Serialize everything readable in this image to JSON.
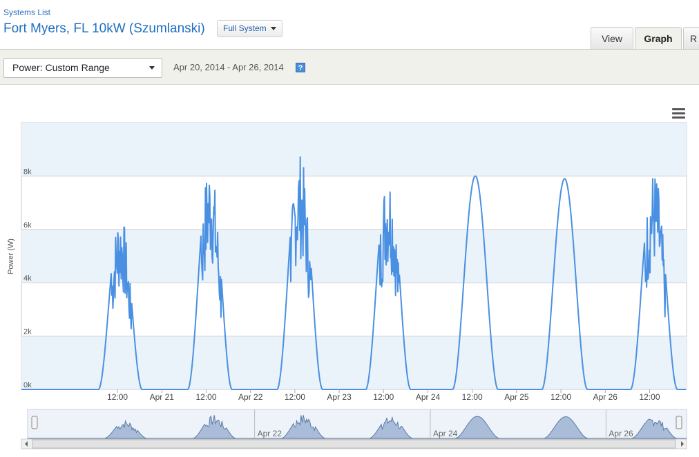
{
  "header": {
    "breadcrumb": "Systems List",
    "title": "Fort Myers, FL 10kW (Szumlanski)",
    "system_select": "Full System"
  },
  "tabs": [
    {
      "label": "View",
      "active": false
    },
    {
      "label": "Graph",
      "active": true
    },
    {
      "label": "R",
      "active": false
    }
  ],
  "toolbar": {
    "range_select": "Power: Custom Range",
    "date_range": "Apr 20, 2014 - Apr 26, 2014",
    "help": "?"
  },
  "colors": {
    "line": "#4a90e2",
    "band": "#eaf2fa",
    "navigator_fill": "#a9bdd9",
    "navigator_line": "#5a79a6"
  },
  "chart_data": {
    "type": "line",
    "title": "",
    "xlabel": "",
    "ylabel": "Power (W)",
    "ylim": [
      0,
      10000
    ],
    "yticks": [
      0,
      2000,
      4000,
      6000,
      8000
    ],
    "ytick_labels": [
      "0k",
      "2k",
      "4k",
      "6k",
      "8k"
    ],
    "xlim_hours": [
      -14,
      166
    ],
    "x_tick_labels": [
      "12:00",
      "Apr 21",
      "12:00",
      "Apr 22",
      "12:00",
      "Apr 23",
      "12:00",
      "Apr 24",
      "12:00",
      "Apr 25",
      "12:00",
      "Apr 26",
      "12:00"
    ],
    "grid": true,
    "legend": "none",
    "series": [
      {
        "days": [
          {
            "date": "Apr 20",
            "start": "06:50",
            "end": "18:40",
            "peak": 6700,
            "noisy": true,
            "dip": 500
          },
          {
            "date": "Apr 21",
            "start": "07:00",
            "end": "19:00",
            "peak": 8600,
            "noisy": true,
            "dip": 0
          },
          {
            "date": "Apr 22",
            "start": "07:10",
            "end": "19:30",
            "peak": 8900,
            "noisy": true,
            "dip": 0
          },
          {
            "date": "Apr 23",
            "start": "07:10",
            "end": "19:20",
            "peak": 8300,
            "noisy": true,
            "dip": 0
          },
          {
            "date": "Apr 24",
            "start": "06:40",
            "end": "19:00",
            "peak": 8000,
            "noisy": false,
            "dip": 0
          },
          {
            "date": "Apr 25",
            "start": "06:50",
            "end": "19:10",
            "peak": 7900,
            "noisy": false,
            "dip": 0
          },
          {
            "date": "Apr 26",
            "start": "06:50",
            "end": "19:30",
            "peak": 8300,
            "noisy": true,
            "dip": 0
          }
        ]
      }
    ]
  },
  "navigator": {
    "labels": [
      "Apr 22",
      "Apr 24",
      "Apr 26"
    ]
  }
}
